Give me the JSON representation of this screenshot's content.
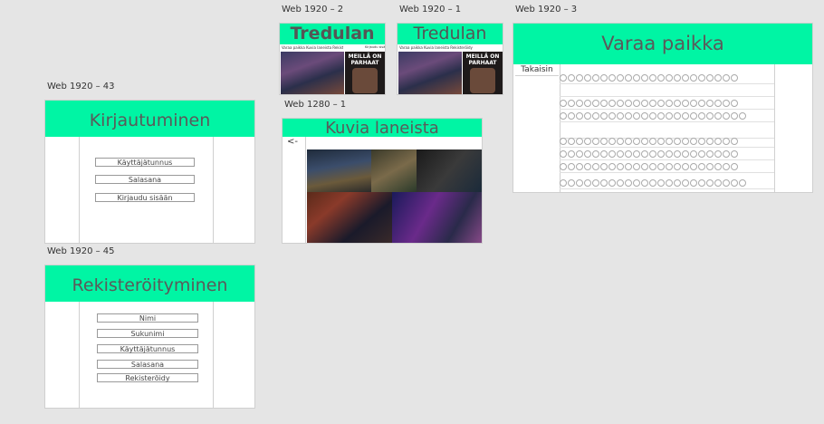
{
  "labels": {
    "web2": "Web 1920 – 2",
    "web1": "Web 1920 – 1",
    "web3": "Web 1920 – 3",
    "web43": "Web 1920 – 43",
    "web45": "Web 1920 – 45",
    "web1280": "Web 1280 – 1"
  },
  "tredulan2": {
    "title": "Tredulan",
    "nav": "Varaa paikka  Kuvia laneista  Rekisteröidy",
    "nav_right": "Kirjaudu sisään",
    "promo": "MEILLÄ ON PARHAAT"
  },
  "tredulan1": {
    "title": "Tredulan",
    "nav": "Varaa paikka  Kuvia laneista  Rekisteröidy",
    "nav_right": "",
    "promo": "MEILLÄ ON PARHAAT"
  },
  "varaa": {
    "title": "Varaa paikka",
    "back": "Takaisin"
  },
  "kuvia": {
    "title": "Kuvia laneista",
    "back": "<-"
  },
  "login": {
    "title": "Kirjautuminen",
    "username": "Käyttäjätunnus",
    "password": "Salasana",
    "submit": "Kirjaudu sisään"
  },
  "register": {
    "title": "Rekisteröityminen",
    "name": "Nimi",
    "surname": "Sukunimi",
    "username": "Käyttäjätunnus",
    "password": "Salasana",
    "submit": "Rekisteröidy"
  },
  "colors": {
    "accent": "#00f5a4",
    "canvas": "#e5e5e5"
  }
}
